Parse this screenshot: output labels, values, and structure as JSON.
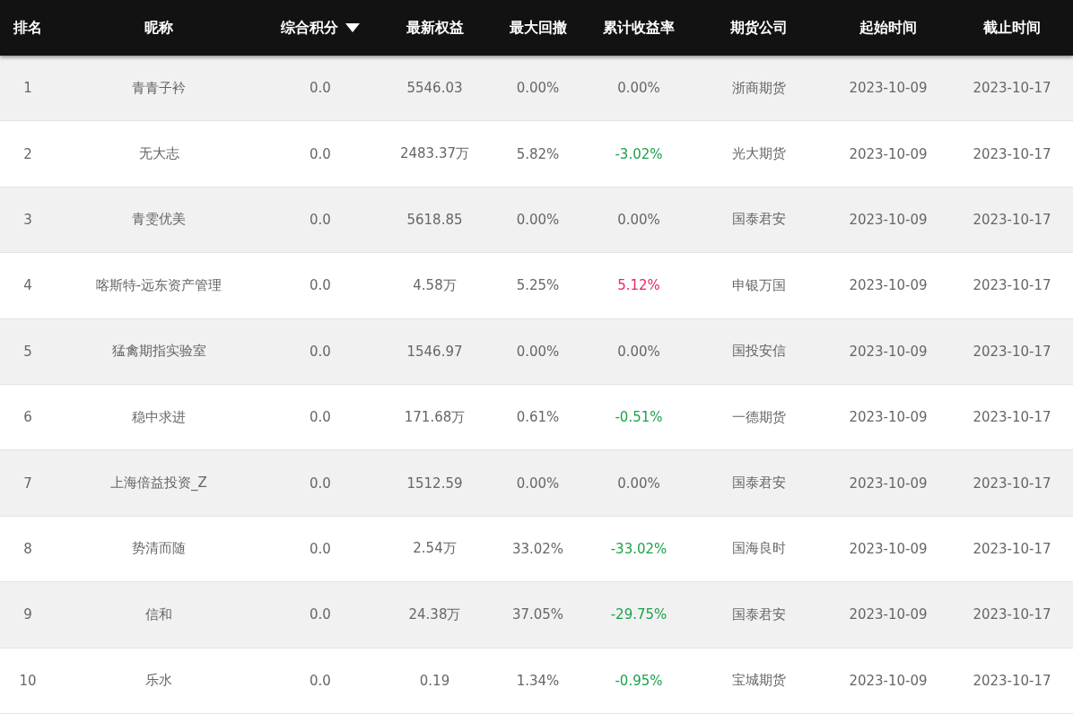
{
  "columns": [
    {
      "label": "排名",
      "sorted": false
    },
    {
      "label": "昵称",
      "sorted": false
    },
    {
      "label": "综合积分",
      "sorted": true
    },
    {
      "label": "最新权益",
      "sorted": false
    },
    {
      "label": "最大回撤",
      "sorted": false
    },
    {
      "label": "累计收益率",
      "sorted": false
    },
    {
      "label": "期货公司",
      "sorted": false
    },
    {
      "label": "起始时间",
      "sorted": false
    },
    {
      "label": "截止时间",
      "sorted": false
    }
  ],
  "rows": [
    {
      "rank": "1",
      "nickname": "青青子衿",
      "score": "0.0",
      "equity": "5546.03",
      "drawdown": "0.00%",
      "return": {
        "text": "0.00%",
        "color": "#666666"
      },
      "company": "浙商期货",
      "start": "2023-10-09",
      "end": "2023-10-17"
    },
    {
      "rank": "2",
      "nickname": "无大志",
      "score": "0.0",
      "equity": "2483.37万",
      "drawdown": "5.82%",
      "return": {
        "text": "-3.02%",
        "color": "#1aa34a"
      },
      "company": "光大期货",
      "start": "2023-10-09",
      "end": "2023-10-17"
    },
    {
      "rank": "3",
      "nickname": "青雯优美",
      "score": "0.0",
      "equity": "5618.85",
      "drawdown": "0.00%",
      "return": {
        "text": "0.00%",
        "color": "#666666"
      },
      "company": "国泰君安",
      "start": "2023-10-09",
      "end": "2023-10-17"
    },
    {
      "rank": "4",
      "nickname": "喀斯特-远东资产管理",
      "score": "0.0",
      "equity": "4.58万",
      "drawdown": "5.25%",
      "return": {
        "text": "5.12%",
        "color": "#e8246e"
      },
      "company": "申银万国",
      "start": "2023-10-09",
      "end": "2023-10-17"
    },
    {
      "rank": "5",
      "nickname": "猛禽期指实验室",
      "score": "0.0",
      "equity": "1546.97",
      "drawdown": "0.00%",
      "return": {
        "text": "0.00%",
        "color": "#666666"
      },
      "company": "国投安信",
      "start": "2023-10-09",
      "end": "2023-10-17"
    },
    {
      "rank": "6",
      "nickname": "稳中求进",
      "score": "0.0",
      "equity": "171.68万",
      "drawdown": "0.61%",
      "return": {
        "text": "-0.51%",
        "color": "#1aa34a"
      },
      "company": "一德期货",
      "start": "2023-10-09",
      "end": "2023-10-17"
    },
    {
      "rank": "7",
      "nickname": "上海倍益投资_Z",
      "score": "0.0",
      "equity": "1512.59",
      "drawdown": "0.00%",
      "return": {
        "text": "0.00%",
        "color": "#666666"
      },
      "company": "国泰君安",
      "start": "2023-10-09",
      "end": "2023-10-17"
    },
    {
      "rank": "8",
      "nickname": "势清而随",
      "score": "0.0",
      "equity": "2.54万",
      "drawdown": "33.02%",
      "return": {
        "text": "-33.02%",
        "color": "#1aa34a"
      },
      "company": "国海良时",
      "start": "2023-10-09",
      "end": "2023-10-17"
    },
    {
      "rank": "9",
      "nickname": "信和",
      "score": "0.0",
      "equity": "24.38万",
      "drawdown": "37.05%",
      "return": {
        "text": "-29.75%",
        "color": "#1aa34a"
      },
      "company": "国泰君安",
      "start": "2023-10-09",
      "end": "2023-10-17"
    },
    {
      "rank": "10",
      "nickname": "乐水",
      "score": "0.0",
      "equity": "0.19",
      "drawdown": "1.34%",
      "return": {
        "text": "-0.95%",
        "color": "#1aa34a"
      },
      "company": "宝城期货",
      "start": "2023-10-09",
      "end": "2023-10-17"
    }
  ]
}
